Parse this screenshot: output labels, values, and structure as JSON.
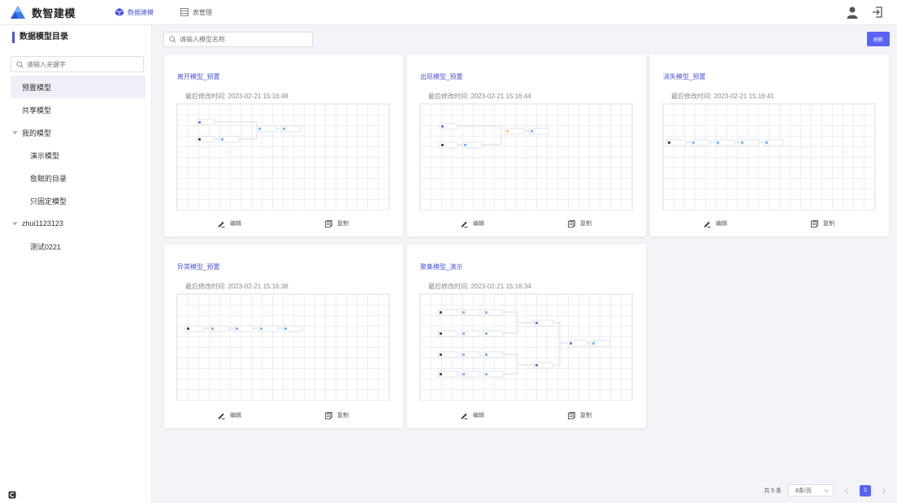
{
  "app": {
    "title": "数智建模"
  },
  "nav": [
    {
      "label": "数据建模",
      "active": true
    },
    {
      "label": "表管理",
      "active": false
    }
  ],
  "header_icons": [
    "user-icon",
    "logout-icon"
  ],
  "sidebar": {
    "title": "数据模型目录",
    "search_placeholder": "请输入关键字",
    "items": [
      {
        "label": "预置模型"
      },
      {
        "label": "共享模型"
      },
      {
        "label": "我的模型"
      },
      {
        "label": "演示模型"
      },
      {
        "label": "詹聪的目录"
      },
      {
        "label": "只固定模型"
      },
      {
        "label": "zhui1123123"
      },
      {
        "label": "测试0221"
      }
    ]
  },
  "main": {
    "search_placeholder": "请输入模型名称",
    "refresh_label": "刷新"
  },
  "cards": [
    {
      "title": "离开模型_预置",
      "time": "最后修改时间: 2023-02-21 15:16:48",
      "edit": "编辑",
      "copy": "复制"
    },
    {
      "title": "出现模型_预置",
      "time": "最后修改时间: 2023-02-21 15:16:44",
      "edit": "编辑",
      "copy": "复制"
    },
    {
      "title": "消失模型_预置",
      "time": "最后修改时间: 2023-02-21 15:16:41",
      "edit": "编辑",
      "copy": "复制"
    },
    {
      "title": "异常模型_预置",
      "time": "最后修改时间: 2023-02-21 15:16:38",
      "edit": "编辑",
      "copy": "复制"
    },
    {
      "title": "聚集模型_演示",
      "time": "最后修改时间: 2023-02-21 15:16:34",
      "edit": "编辑",
      "copy": "复制"
    }
  ],
  "pagination": {
    "total": "共 5 条",
    "page_size": "8条/页",
    "current": "1"
  },
  "colors": {
    "accent": "#5a64f2",
    "link": "#4a55e0"
  }
}
